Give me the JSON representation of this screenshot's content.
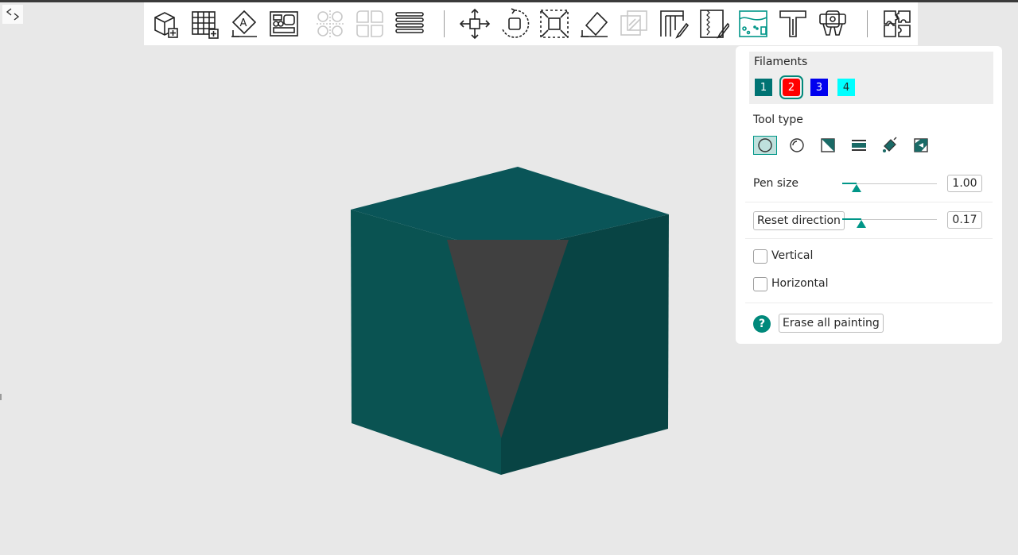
{
  "panel": {
    "filaments_title": "Filaments",
    "filaments": [
      {
        "label": "1",
        "color": "#007373",
        "text_color": "#ffffff"
      },
      {
        "label": "2",
        "color": "#ff0000",
        "text_color": "#ffffff",
        "selected": true
      },
      {
        "label": "3",
        "color": "#0000ee",
        "text_color": "#ffffff"
      },
      {
        "label": "4",
        "color": "#00ffff",
        "text_color": "#262626"
      }
    ],
    "tool_type_title": "Tool type",
    "tool_icons": [
      "circle-brush-icon",
      "sphere-brush-icon",
      "triangle-brush-icon",
      "height-range-icon",
      "fill-bucket-icon",
      "gap-fill-icon"
    ],
    "selected_tool": "circle-brush-icon",
    "pen_size_label": "Pen size",
    "pen_size_value": "1.00",
    "pen_size_fraction": 0.15,
    "reset_direction_label": "Reset direction",
    "reset_direction_value": "0.17",
    "reset_direction_fraction": 0.2,
    "vertical_label": "Vertical",
    "vertical_checked": false,
    "horizontal_label": "Horizontal",
    "horizontal_checked": false,
    "help_symbol": "?",
    "erase_label": "Erase all painting"
  },
  "toolbar": {
    "icons": [
      "add-object-icon",
      "add-plate-icon",
      "auto-orient-icon",
      "arrange-icon",
      "split-objects-icon",
      "split-parts-icon",
      "layers-icon",
      "move-icon",
      "rotate-icon",
      "scale-icon",
      "lay-on-face-icon",
      "cut-icon",
      "support-paint-icon",
      "seam-paint-icon",
      "color-paint-icon",
      "text-icon",
      "measure-icon",
      "assembly-icon"
    ],
    "active_tool": "color-paint-icon"
  },
  "colors": {
    "accent": "#009688",
    "cube_top": "#0a5558",
    "cube_left": "#0a5352",
    "cube_right": "#084444",
    "painted_face": "#404040"
  }
}
